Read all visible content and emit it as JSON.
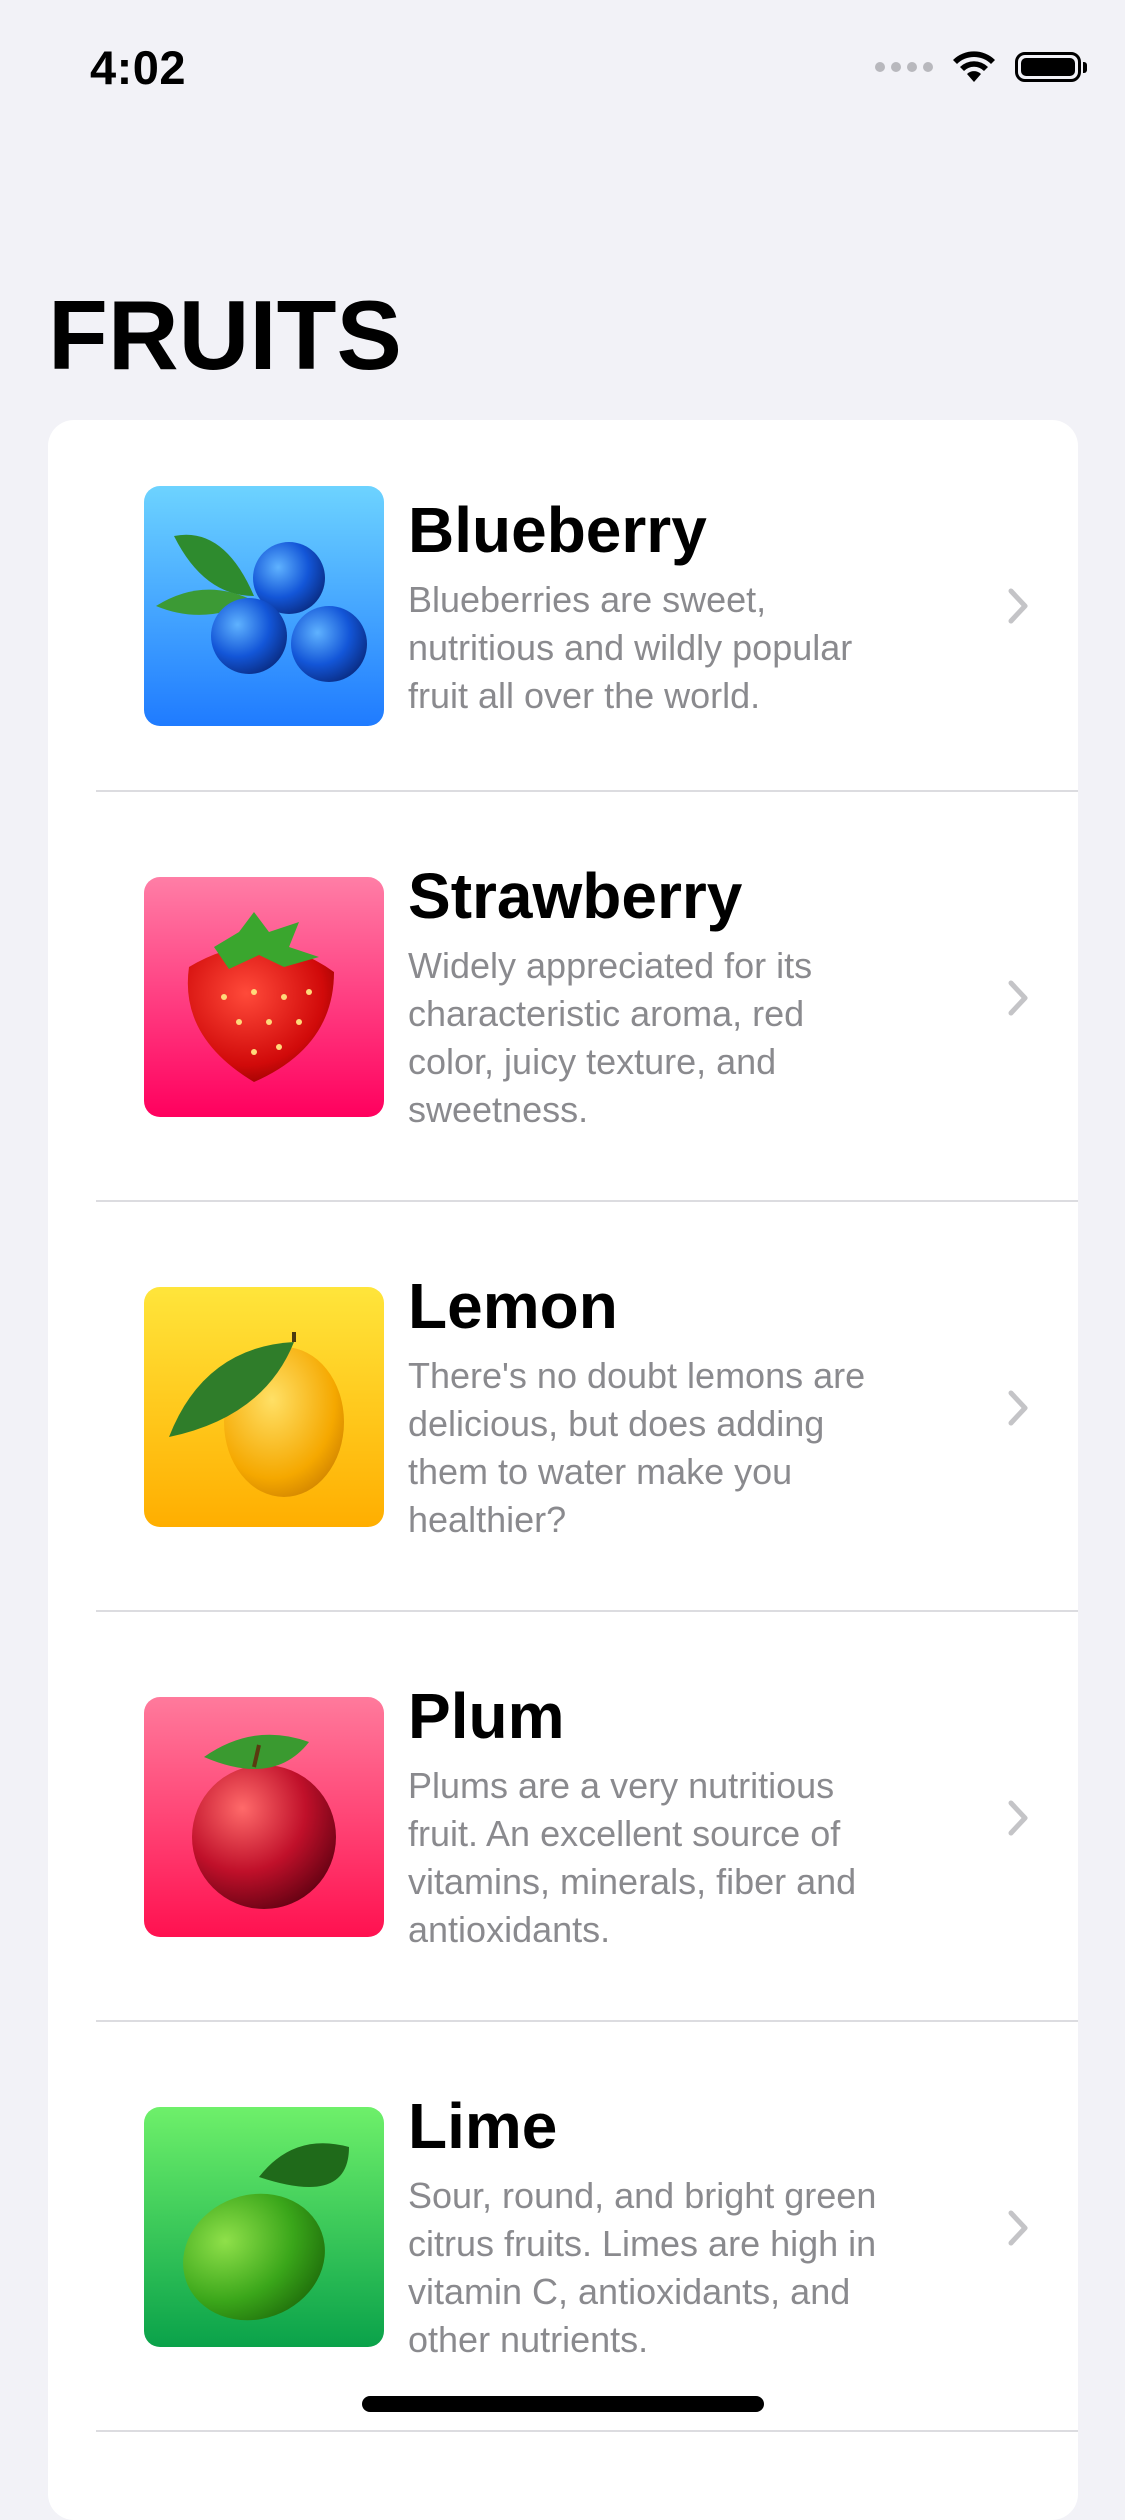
{
  "status_bar": {
    "time": "4:02"
  },
  "page": {
    "title": "FRUITS"
  },
  "fruits": [
    {
      "name": "Blueberry",
      "description": "Blueberries are sweet,\nnutritious and wildly popular\nfruit all over the world.",
      "gradient": [
        "#6dd3ff",
        "#1f7bff"
      ]
    },
    {
      "name": "Strawberry",
      "description": "Widely appreciated for its\ncharacteristic aroma,  red\ncolor, juicy texture, and\nsweetness.",
      "gradient": [
        "#ff7ea6",
        "#ff005e"
      ]
    },
    {
      "name": "Lemon",
      "description": "There's no doubt lemons are\ndelicious, but does adding\nthem to water make you\nhealthier?",
      "gradient": [
        "#ffe53b",
        "#ffae00"
      ]
    },
    {
      "name": "Plum",
      "description": "Plums are a very nutritious\nfruit. An excellent source of\nvitamins, minerals, fiber and\nantioxidants.",
      "gradient": [
        "#ff7a9c",
        "#ff1150"
      ]
    },
    {
      "name": "Lime",
      "description": "Sour, round, and bright green\ncitrus fruits. Limes are high in\nvitamin C, antioxidants, and\nother nutrients.",
      "gradient": [
        "#6ef06a",
        "#0aa24a"
      ]
    }
  ],
  "colors": {
    "background": "#f2f2f7",
    "card": "#ffffff",
    "secondary_text": "#8a8a8e",
    "chevron": "#c4c4c7"
  }
}
